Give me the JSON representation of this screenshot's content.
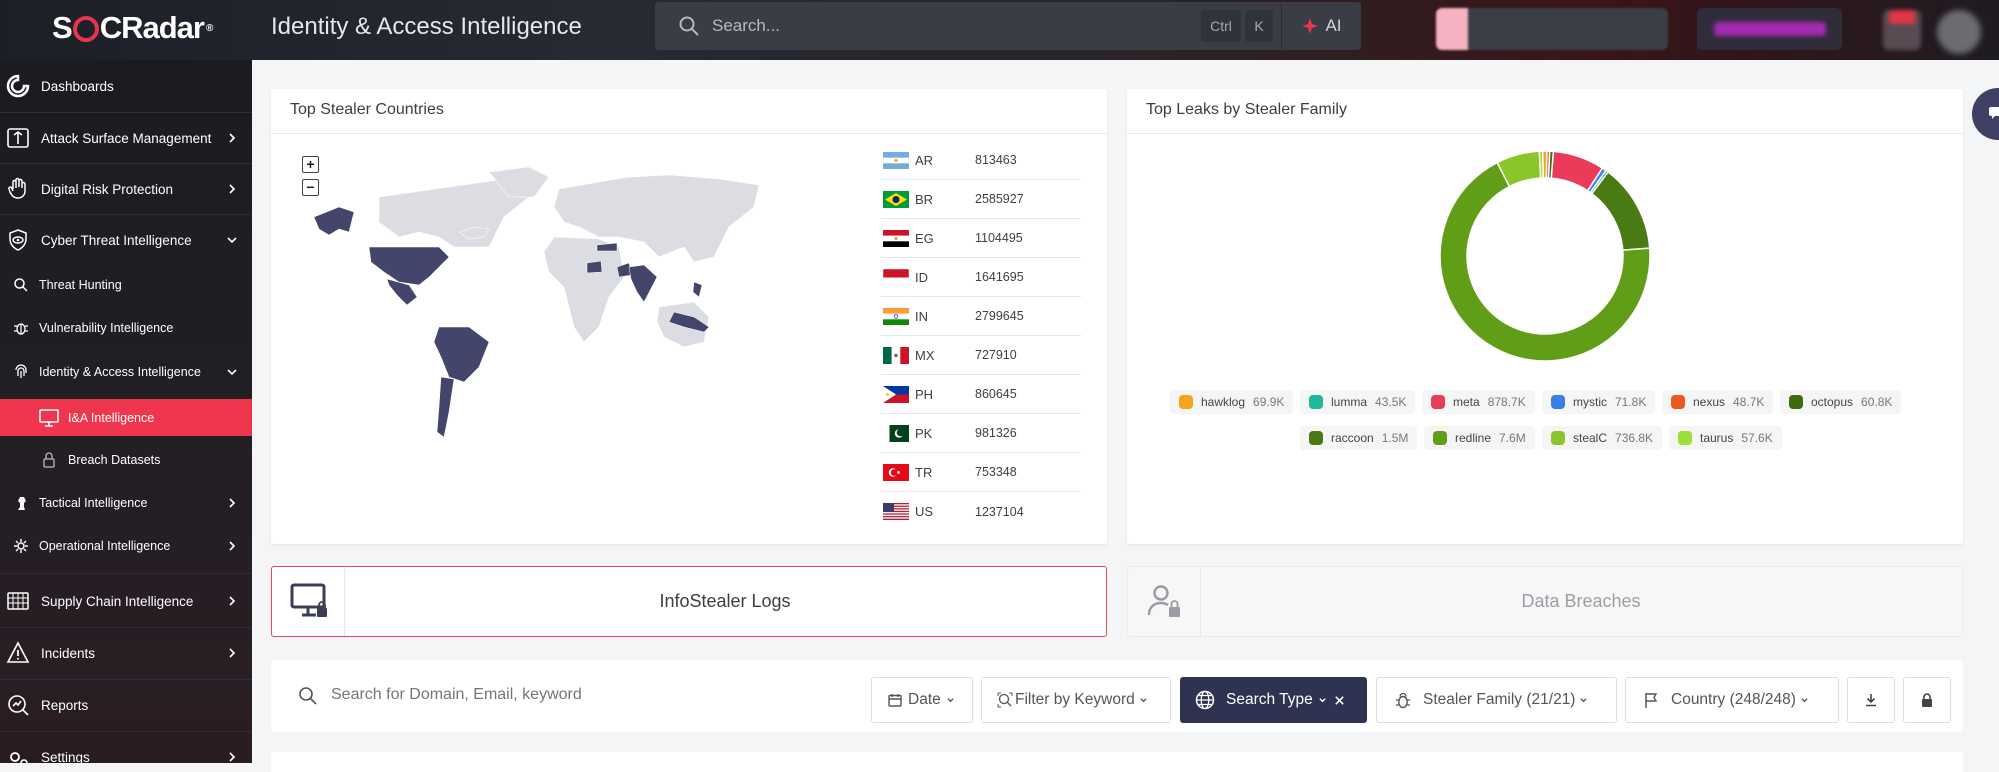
{
  "app": {
    "brand": "SOCRadar",
    "title": "Identity & Access Intelligence"
  },
  "search": {
    "placeholder": "Search...",
    "kbd1": "Ctrl",
    "kbd2": "K",
    "ai": "AI"
  },
  "sidebar": {
    "items": [
      {
        "label": "Dashboards",
        "icon": "dashboard-icon"
      },
      {
        "label": "Attack Surface Management",
        "icon": "attack-surface-icon"
      },
      {
        "label": "Digital Risk Protection",
        "icon": "hand-icon"
      },
      {
        "label": "Cyber Threat Intelligence",
        "icon": "eye-shield-icon"
      },
      {
        "label": "Threat Hunting",
        "icon": "search-icon"
      },
      {
        "label": "Vulnerability Intelligence",
        "icon": "bug-icon"
      },
      {
        "label": "Identity & Access Intelligence",
        "icon": "fingerprint-icon"
      },
      {
        "label": "I&A Intelligence",
        "icon": "monitor-icon"
      },
      {
        "label": "Breach Datasets",
        "icon": "lock-file-icon"
      },
      {
        "label": "Tactical Intelligence",
        "icon": "chess-icon"
      },
      {
        "label": "Operational Intelligence",
        "icon": "gear-icon"
      },
      {
        "label": "Supply Chain Intelligence",
        "icon": "supply-chain-icon"
      },
      {
        "label": "Incidents",
        "icon": "alert-icon"
      },
      {
        "label": "Reports",
        "icon": "reports-icon"
      },
      {
        "label": "Settings",
        "icon": "settings-icon"
      }
    ]
  },
  "countries_card": {
    "title": "Top Stealer Countries",
    "zoom_in": "+",
    "zoom_out": "−",
    "rows": [
      {
        "code": "AR",
        "value": "813463"
      },
      {
        "code": "BR",
        "value": "2585927"
      },
      {
        "code": "EG",
        "value": "1104495"
      },
      {
        "code": "ID",
        "value": "1641695"
      },
      {
        "code": "IN",
        "value": "2799645"
      },
      {
        "code": "MX",
        "value": "727910"
      },
      {
        "code": "PH",
        "value": "860645"
      },
      {
        "code": "PK",
        "value": "981326"
      },
      {
        "code": "TR",
        "value": "753348"
      },
      {
        "code": "US",
        "value": "1237104"
      }
    ]
  },
  "families_card": {
    "title": "Top Leaks by Stealer Family"
  },
  "chart_data": {
    "type": "pie",
    "title": "Top Leaks by Stealer Family",
    "categories": [
      "hawklog",
      "lumma",
      "meta",
      "mystic",
      "nexus",
      "octopus",
      "raccoon",
      "redline",
      "stealC",
      "taurus"
    ],
    "values": [
      69900,
      43500,
      878700,
      71800,
      48700,
      60800,
      1500000,
      7600000,
      736800,
      57600
    ],
    "labels": [
      "69.9K",
      "43.5K",
      "878.7K",
      "71.8K",
      "48.7K",
      "60.8K",
      "1.5M",
      "7.6M",
      "736.8K",
      "57.6K"
    ],
    "colors": [
      "#f7a41d",
      "#20b89a",
      "#eb3b5a",
      "#3b7ee8",
      "#ea5a1f",
      "#3e6b10",
      "#4a7a14",
      "#5f9e16",
      "#8ac52a",
      "#9be038"
    ]
  },
  "tabs": {
    "infostealer": "InfoStealer Logs",
    "breaches": "Data Breaches"
  },
  "filters": {
    "search_placeholder": "Search for Domain, Email, keyword",
    "date": "Date",
    "keyword": "Filter by Keyword",
    "search_type": "Search Type",
    "stealer_family": "Stealer Family (21/21)",
    "country": "Country (248/248)"
  }
}
